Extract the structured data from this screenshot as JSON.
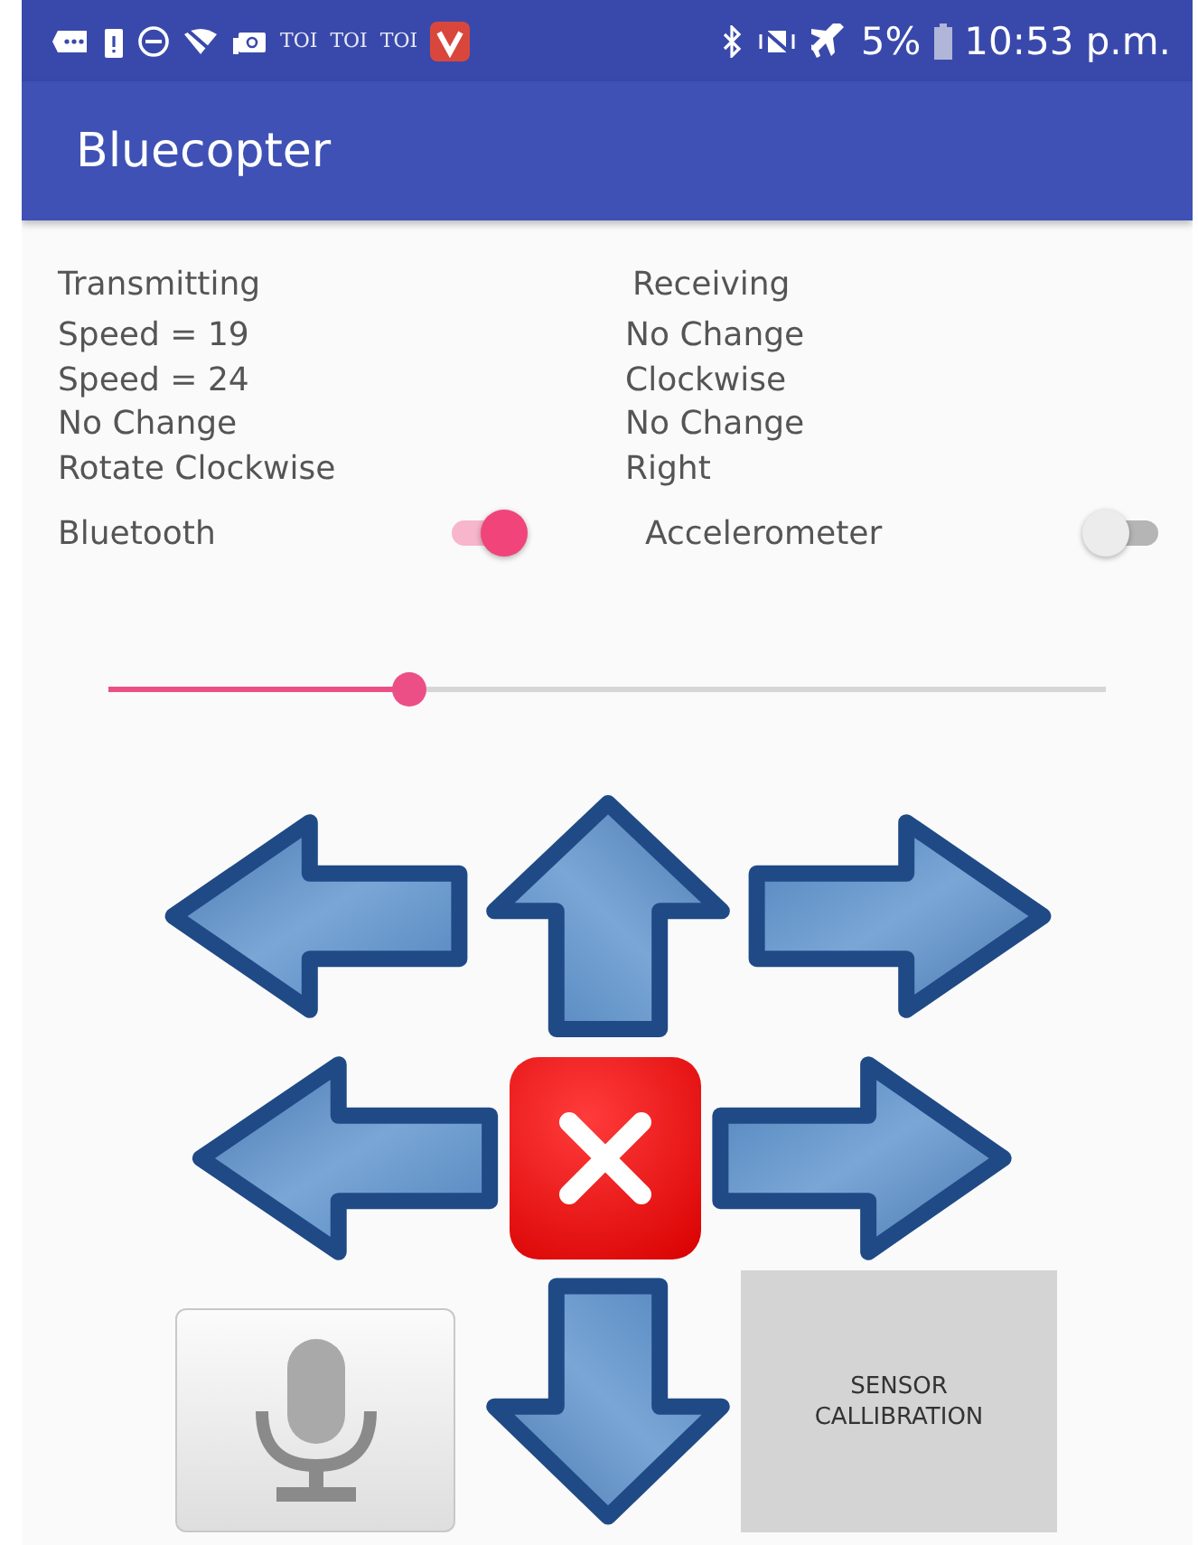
{
  "status_bar": {
    "notification_texts": [
      "TOI",
      "TOI",
      "TOI"
    ],
    "battery": "5%",
    "time": "10:53 p.m."
  },
  "app_bar": {
    "title": "Bluecopter"
  },
  "transmitting": {
    "heading": "Transmitting",
    "lines": [
      "Speed = 19",
      "Speed = 24",
      "No Change",
      "Rotate Clockwise"
    ]
  },
  "receiving": {
    "heading": "Receiving",
    "lines": [
      "No Change",
      "Clockwise",
      "No Change",
      "Right"
    ]
  },
  "toggles": [
    {
      "label": "Bluetooth",
      "on": true
    },
    {
      "label": "Accelerometer",
      "on": false
    }
  ],
  "slider": {
    "level": 0.3
  },
  "pad_rows": [
    [
      {
        "kind": "left_arrow"
      },
      {
        "kind": "up_arrow"
      },
      {
        "kind": "right_arrow"
      }
    ],
    [
      {
        "kind": "left_arrow"
      },
      {
        "kind": "stop"
      },
      {
        "kind": "right_arrow"
      }
    ],
    [
      {
        "kind": "mic"
      },
      {
        "kind": "down_arrow"
      },
      {
        "kind": "text",
        "label": "SENSOR CALLIBRATION"
      }
    ]
  ]
}
